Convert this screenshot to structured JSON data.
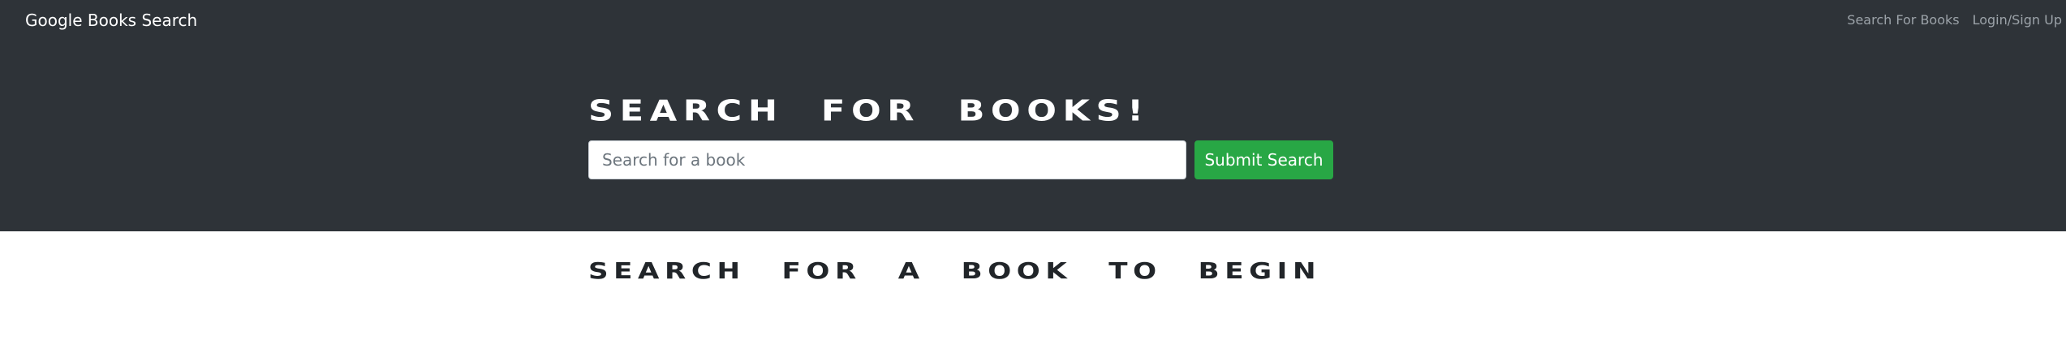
{
  "navbar": {
    "brand": "Google Books Search",
    "links": [
      {
        "label": "Search For Books"
      },
      {
        "label": "Login/Sign Up"
      }
    ]
  },
  "hero": {
    "title": "Search for Books!",
    "search": {
      "value": "",
      "placeholder": "Search for a book"
    },
    "submit_label": "Submit Search"
  },
  "results": {
    "heading": "Search for a book to begin"
  },
  "colors": {
    "hero_background": "#2e3338",
    "submit_button": "#28a745",
    "nav_link": "#9ca3a9"
  }
}
